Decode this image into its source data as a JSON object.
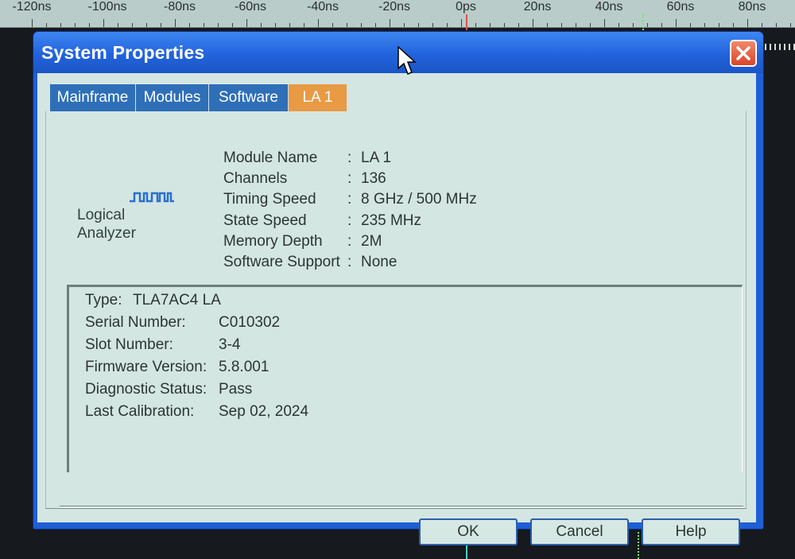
{
  "ruler": {
    "labels": [
      "-120ns",
      "-100ns",
      "-80ns",
      "-60ns",
      "-40ns",
      "-20ns",
      "0ps",
      "20ns",
      "40ns",
      "60ns",
      "80ns"
    ]
  },
  "dialog": {
    "title": "System Properties",
    "close_icon": "close-icon",
    "tabs": [
      {
        "label": "Mainframe",
        "active": false
      },
      {
        "label": "Modules",
        "active": false
      },
      {
        "label": "Software",
        "active": false
      },
      {
        "label": "LA 1",
        "active": true
      }
    ],
    "module": {
      "icon": "logic-analyzer-icon",
      "icon_label_line1": "Logical",
      "icon_label_line2": "Analyzer",
      "properties": [
        {
          "name": "Module Name",
          "value": "LA 1"
        },
        {
          "name": "Channels",
          "value": "136"
        },
        {
          "name": "Timing Speed",
          "value": "8 GHz / 500 MHz"
        },
        {
          "name": "State Speed",
          "value": "235 MHz"
        },
        {
          "name": "Memory Depth",
          "value": "2M"
        },
        {
          "name": "Software Support",
          "value": "None"
        }
      ],
      "separator": ":"
    },
    "details": [
      {
        "key": "Type:",
        "value": "TLA7AC4    LA"
      },
      {
        "key": "Serial Number:",
        "value": "C010302"
      },
      {
        "key": "Slot Number:",
        "value": "3-4"
      },
      {
        "key": "Firmware Version:",
        "value": "5.8.001"
      },
      {
        "key": "Diagnostic Status:",
        "value": "Pass"
      },
      {
        "key": "Last Calibration:",
        "value": "Sep 02, 2024"
      }
    ],
    "buttons": {
      "ok": "OK",
      "cancel": "Cancel",
      "help": "Help"
    }
  },
  "colors": {
    "titlebar": "#2263dc",
    "active_tab": "#e89a45",
    "tab": "#2e6fb8",
    "client_bg": "#d4e6e2",
    "close_button": "#d9452a"
  }
}
